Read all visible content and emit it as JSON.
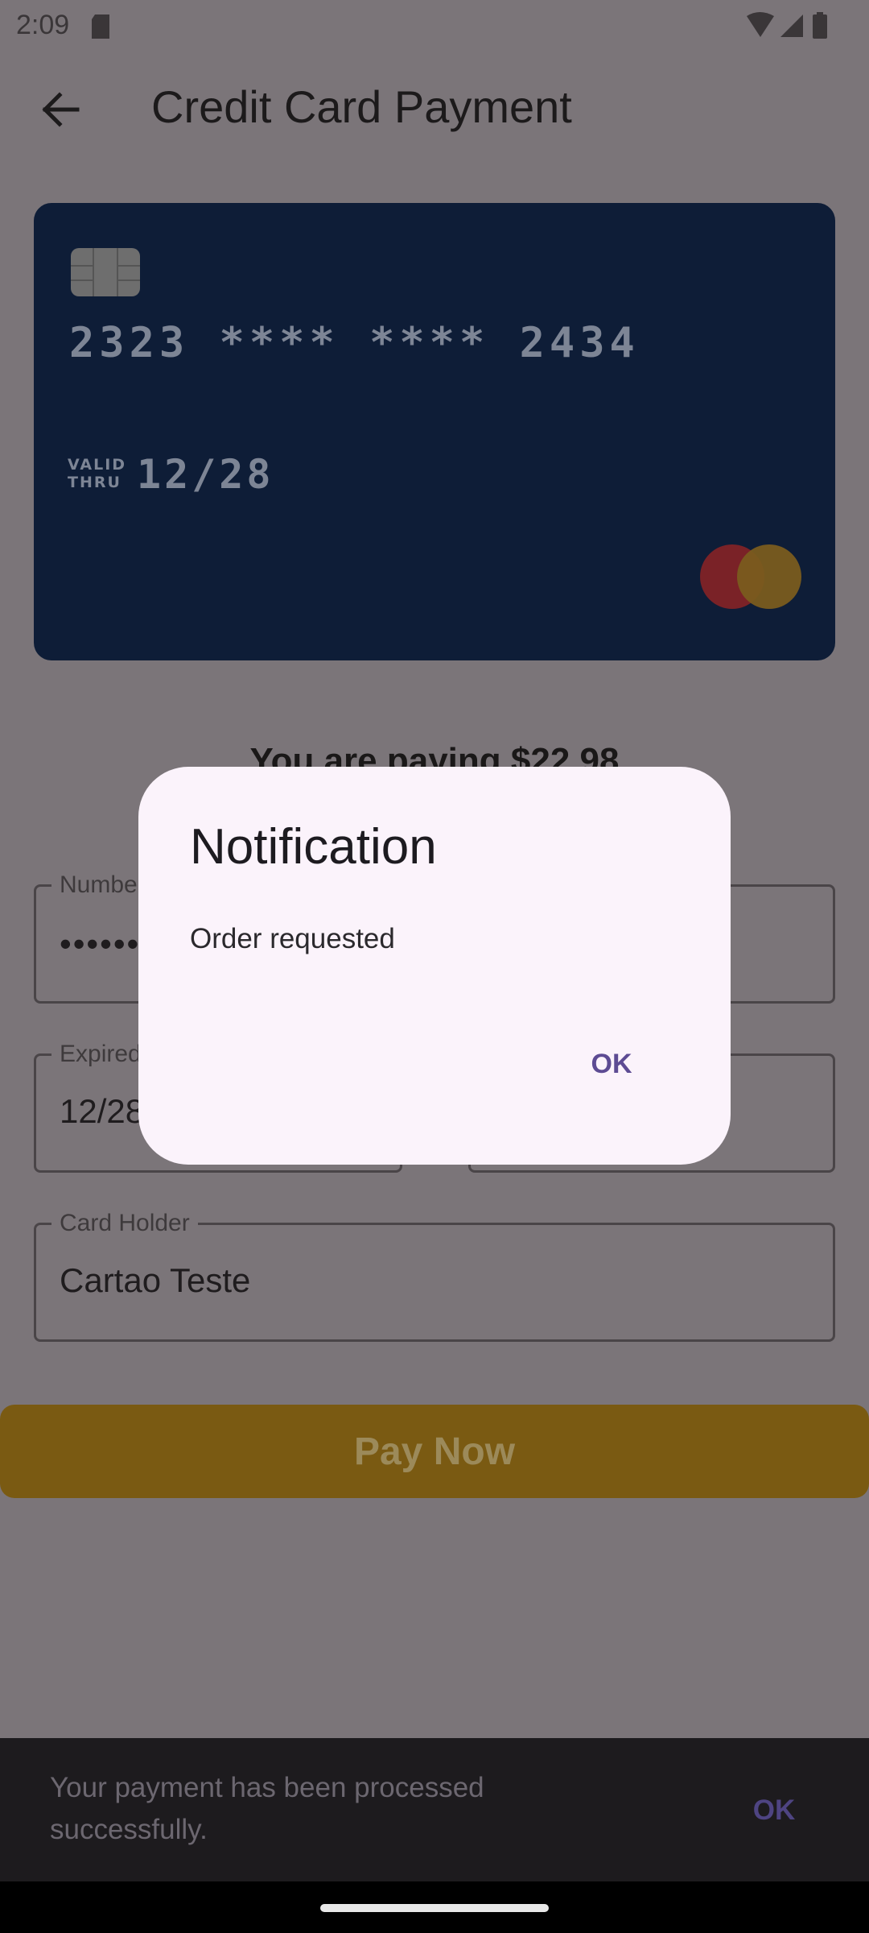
{
  "status_bar": {
    "time": "2:09",
    "icons": [
      "sd-card-icon",
      "wifi-icon",
      "signal-icon",
      "battery-icon"
    ]
  },
  "app_bar": {
    "back_icon": "arrow-back-icon",
    "title": "Credit Card Payment"
  },
  "card": {
    "number": "2323 **** **** 2434",
    "valid_label_line1": "VALID",
    "valid_label_line2": "THRU",
    "expiry": "12/28",
    "brand_icon": "mastercard-icon",
    "colors": {
      "card_bg": "#0e1d37",
      "mc_red": "#7a2227",
      "mc_yellow": "#7a5c1e"
    }
  },
  "summary": {
    "paying_text": "You are paying $22.98"
  },
  "form": {
    "number_label": "Number",
    "number_value": "••••••",
    "expired_label": "Expired",
    "expired_value": "12/28",
    "holder_label": "Card Holder",
    "holder_value": "Cartao Teste"
  },
  "pay_button": {
    "label": "Pay Now",
    "color": "#7a5a12"
  },
  "dialog": {
    "title": "Notification",
    "message": "Order requested",
    "ok_label": "OK",
    "accent": "#5d4b93"
  },
  "snackbar": {
    "message": "Your payment has been processed successfully.",
    "action_label": "OK"
  }
}
